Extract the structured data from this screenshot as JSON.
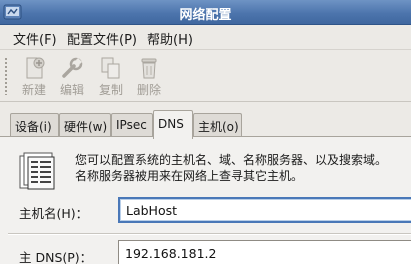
{
  "window": {
    "title": "网络配置"
  },
  "menubar": {
    "items": [
      {
        "label": "文件(F)"
      },
      {
        "label": "配置文件(P)"
      },
      {
        "label": "帮助(H)"
      }
    ]
  },
  "toolbar": {
    "new_label": "新建",
    "edit_label": "编辑",
    "copy_label": "复制",
    "delete_label": "删除"
  },
  "tabs": [
    {
      "label": "设备(i)"
    },
    {
      "label": "硬件(w)"
    },
    {
      "label": "IPsec"
    },
    {
      "label": "DNS",
      "active": true
    },
    {
      "label": "主机(o)"
    }
  ],
  "dns_panel": {
    "info_line1": "您可以配置系统的主机名、域、名称服务器、以及搜索域。",
    "info_line2": "名称服务器被用来在网络上查寻其它主机。",
    "hostname_label": "主机名(H)：",
    "hostname_value": "LabHost",
    "primary_dns_label": "主 DNS(P)：",
    "primary_dns_value": "192.168.181.2"
  }
}
